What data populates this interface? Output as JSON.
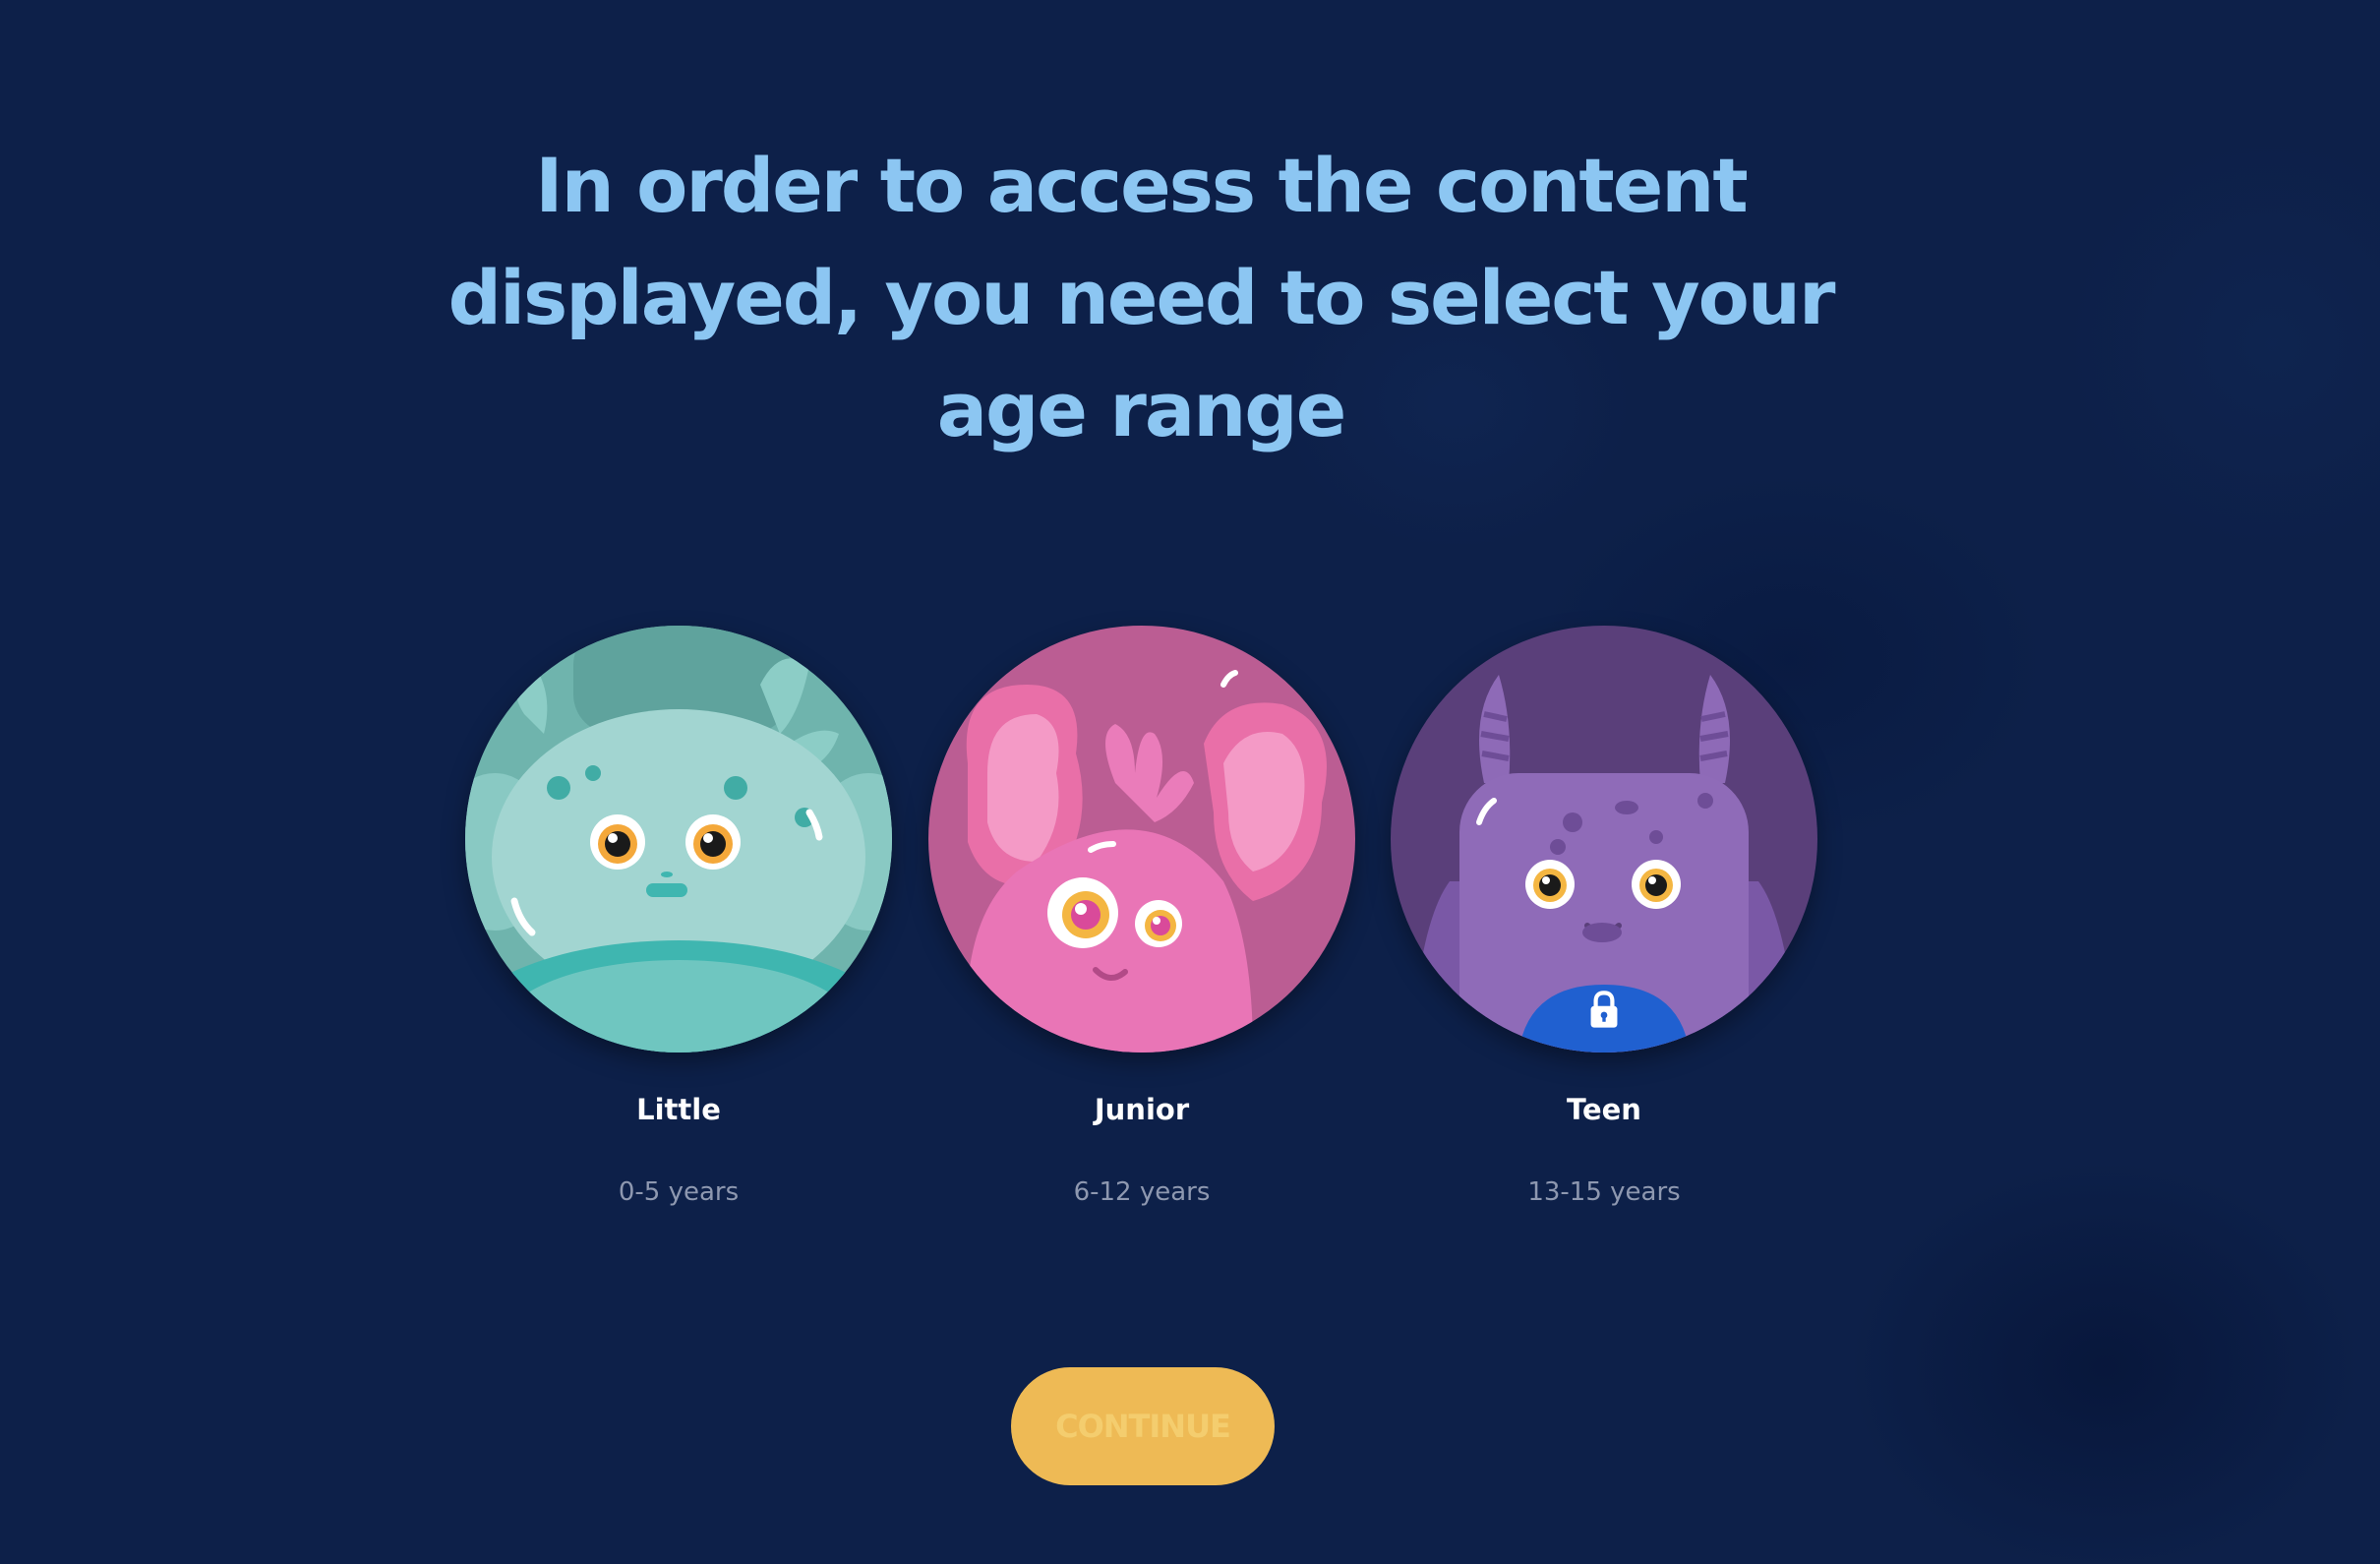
{
  "headline": "In order to access the content displayed, you need to select your age range",
  "age_options": [
    {
      "label": "Little",
      "range": "0-5 years",
      "character": "teal-monster-icon",
      "locked": false
    },
    {
      "label": "Junior",
      "range": "6-12 years",
      "character": "pink-monster-icon",
      "locked": false
    },
    {
      "label": "Teen",
      "range": "13-15 years",
      "character": "purple-monster-icon",
      "locked": true
    }
  ],
  "continue_button": {
    "label": "CONTINUE",
    "enabled": false
  },
  "colors": {
    "background": "#0d2049",
    "headline": "#8cc6f2",
    "button": "#eeba55",
    "button_text": "#f4cd6e",
    "label": "#ffffff",
    "range": "#8e98b0",
    "lock_badge": "#2060d0"
  },
  "icons": {
    "lock": "lock-icon"
  }
}
